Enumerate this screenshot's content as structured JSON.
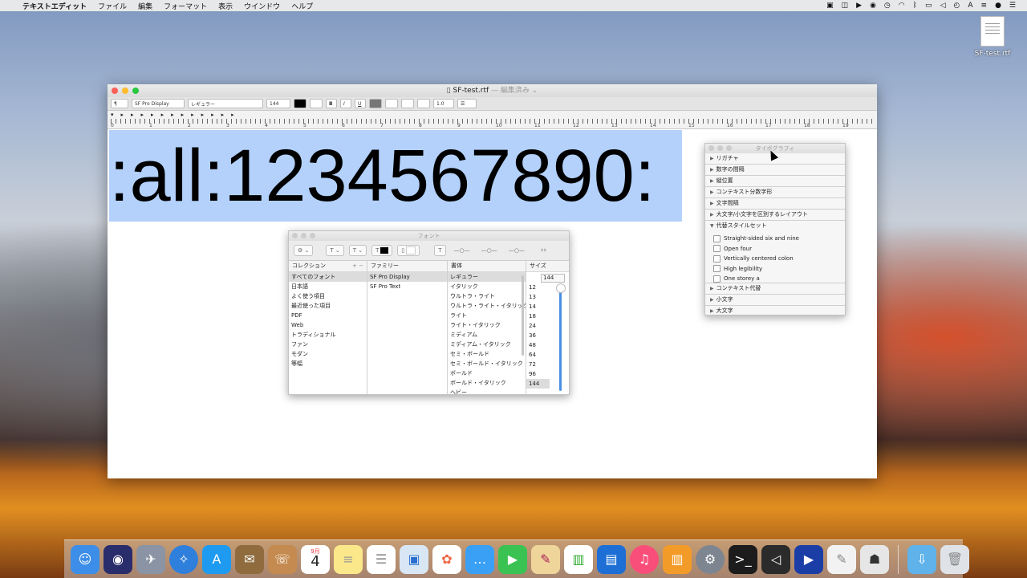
{
  "menubar": {
    "app_name": "テキストエディット",
    "items": [
      "ファイル",
      "編集",
      "フォーマット",
      "表示",
      "ウインドウ",
      "ヘルプ"
    ]
  },
  "desktop": {
    "file_label": "SF-test.rtf"
  },
  "window": {
    "title": "SF-test.rtf",
    "title_status": "— 編集済み ⌄",
    "toolbar": {
      "paragraph_style": "¶",
      "font_family": "SF Pro Display",
      "font_style": "レギュラー",
      "font_size": "144",
      "bold": "B",
      "italic": "I",
      "underline": "U",
      "line_spacing": "1.0"
    },
    "ruler_numbers": [
      "0",
      "1",
      "2",
      "3",
      "4",
      "5",
      "6",
      "7",
      "8",
      "9",
      "10",
      "11",
      "12",
      "13",
      "14",
      "15",
      "16",
      "17",
      "18",
      "19"
    ],
    "document_text": ":all:1234567890:"
  },
  "font_panel": {
    "title": "フォント",
    "columns": {
      "collection": "コレクション",
      "family": "ファミリー",
      "typeface": "書体",
      "size": "サイズ"
    },
    "collections": [
      "すべてのフォント",
      "日本語",
      "よく使う項目",
      "最近使った項目",
      "PDF",
      "Web",
      "トラディショナル",
      "ファン",
      "モダン",
      "等幅"
    ],
    "families": [
      "SF Pro Display",
      "SF Pro Text"
    ],
    "typefaces": [
      "レギュラー",
      "イタリック",
      "ウルトラ・ライト",
      "ウルトラ・ライト・イタリック",
      "ライト",
      "ライト・イタリック",
      "ミディアム",
      "ミディアム・イタリック",
      "セミ・ボールド",
      "セミ・ボールド・イタリック",
      "ボールド",
      "ボールド・イタリック",
      "ヘビー"
    ],
    "size_value": "144",
    "sizes": [
      "12",
      "13",
      "14",
      "18",
      "24",
      "36",
      "48",
      "64",
      "72",
      "96",
      "144"
    ]
  },
  "typography_panel": {
    "title": "タイポグラフィ",
    "sections_top": [
      "リガチャ",
      "数字の間隔",
      "縦位置",
      "コンテキスト分数字形",
      "文字間隔",
      "大文字/小文字を区別するレイアウト"
    ],
    "expanded_section": "代替スタイルセット",
    "options": [
      "Straight-sided six and nine",
      "Open four",
      "Vertically centered colon",
      "High legibility",
      "One storey a"
    ],
    "sections_bottom": [
      "コンテキスト代替",
      "小文字",
      "大文字"
    ]
  },
  "dock": {
    "calendar_day": "4",
    "calendar_month": "9月"
  },
  "colors": {
    "selection": "#b3d1fb",
    "accent": "#4a90e2"
  }
}
